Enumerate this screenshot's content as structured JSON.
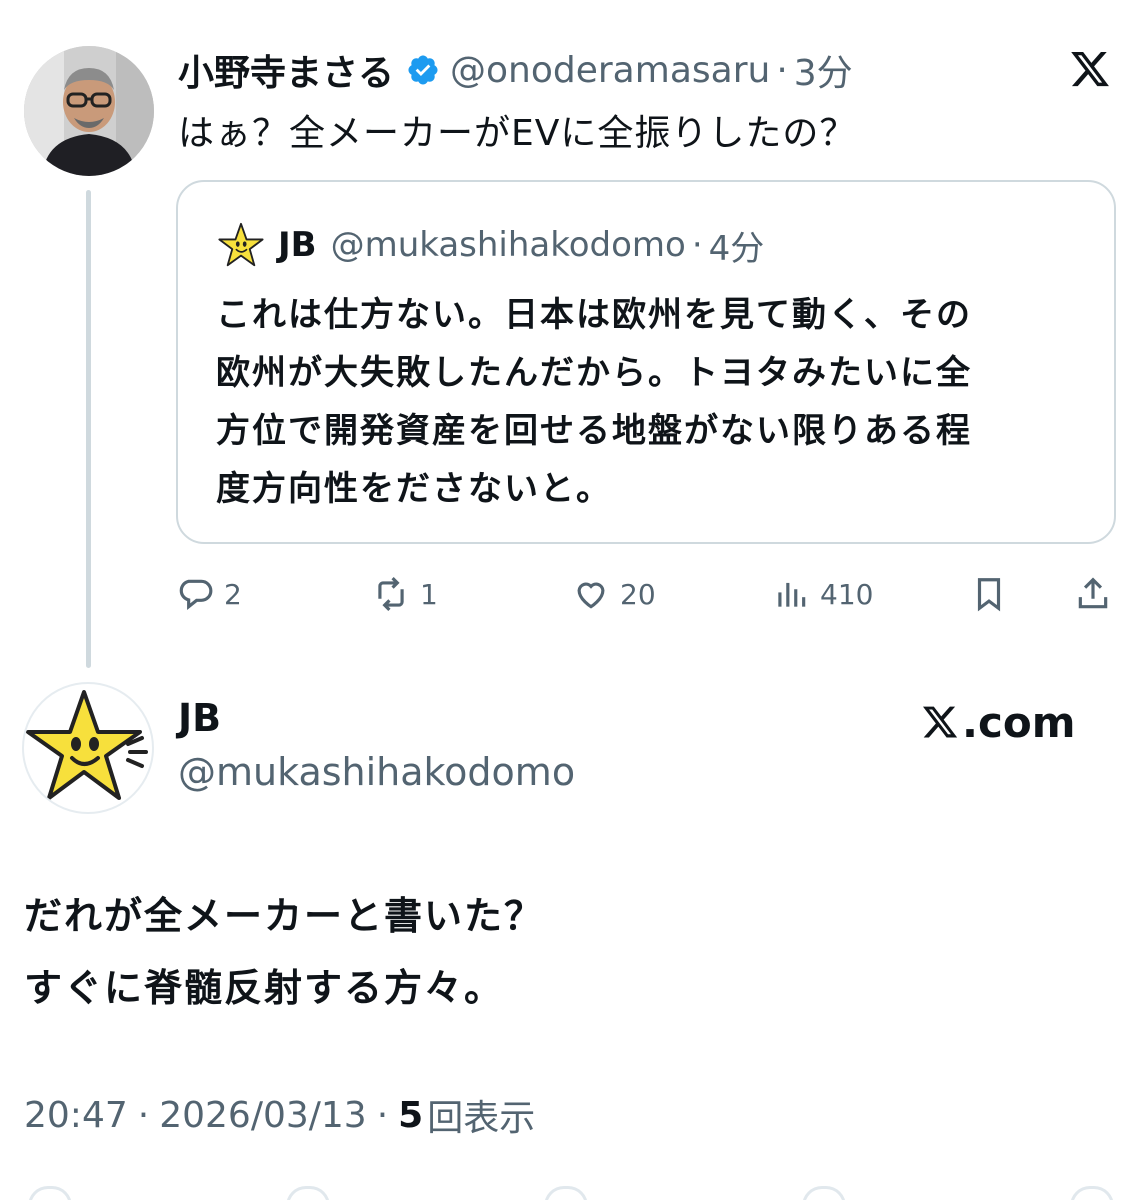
{
  "quoted_tweet": {
    "author_name": "小野寺まさる",
    "verified": true,
    "author_handle": "@onoderamasaru",
    "separator": "·",
    "time": "3分",
    "text": "はぁ？全メーカーがEVに全振りしたの？",
    "quote": {
      "author_name": "JB",
      "author_handle": "@mukashihakodomo",
      "separator": "·",
      "time": "4分",
      "lines": [
        "これは仕方ない。日本は欧州を見て動く、その",
        "欧州が大失敗したんだから。トヨタみたいに全",
        "方位で開発資産を回せる地盤がない限りある程",
        "度方向性をださないと。"
      ]
    },
    "metrics": {
      "replies": "2",
      "reposts": "1",
      "likes": "20",
      "views": "410"
    }
  },
  "main_tweet": {
    "author_name": "JB",
    "author_handle": "@mukashihakodomo",
    "site_label": ".com",
    "lines": [
      "だれが全メーカーと書いた？",
      "すぐに脊髄反射する方々。"
    ],
    "time": "20:47",
    "date": "2026/03/13",
    "separator": "·",
    "views_count": "5",
    "views_label": "回表示"
  },
  "colors": {
    "text_primary": "#0f1419",
    "text_secondary": "#536471",
    "border": "#cfd9de",
    "verified_badge": "#1d9bf0",
    "star": "#f7e03c"
  },
  "icons": [
    "verified-badge-icon",
    "x-logo-icon",
    "reply-icon",
    "repost-icon",
    "like-icon",
    "views-icon",
    "bookmark-icon",
    "share-icon"
  ]
}
